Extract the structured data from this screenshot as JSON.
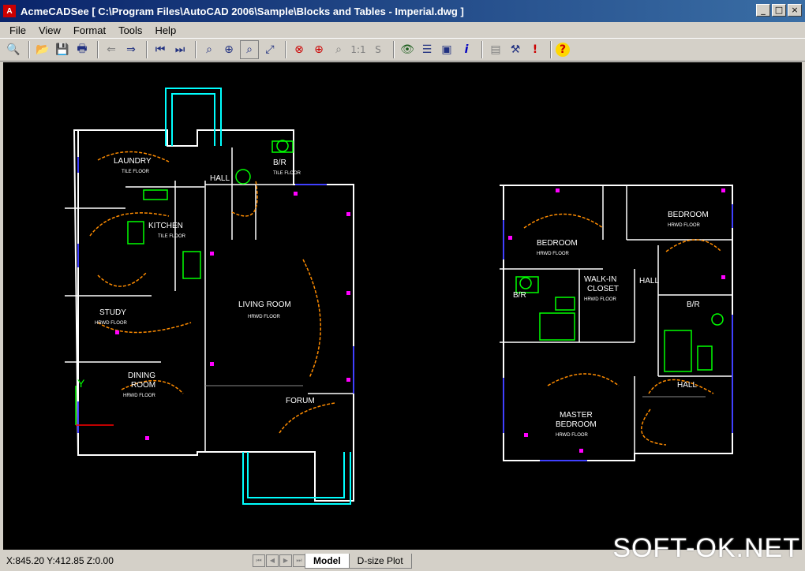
{
  "window": {
    "title": "AcmeCADSee [ C:\\Program Files\\AutoCAD 2006\\Sample\\Blocks and Tables - Imperial.dwg ]",
    "icon": "app-icon"
  },
  "menu": {
    "items": [
      "File",
      "View",
      "Format",
      "Tools",
      "Help"
    ]
  },
  "toolbar": {
    "one_to_one": "1:1",
    "s_label": "S",
    "info": "i",
    "bang": "!",
    "help": "?"
  },
  "drawing": {
    "labels": {
      "laundry": "LAUNDRY",
      "tile_floor": "TILE FLOOR",
      "kitchen": "KITCHEN",
      "hall": "HALL",
      "br": "B/R",
      "study": "STUDY",
      "hrwd_floor": "HRWD FLOOR",
      "living_room": "LIVING ROOM",
      "dining": "DINING",
      "room": "ROOM",
      "forum": "FORUM",
      "bedroom": "BEDROOM",
      "walk_in": "WALK-IN",
      "closet": "CLOSET",
      "master": "MASTER",
      "axis_y": "Y"
    }
  },
  "status": {
    "coords": "X:845.20 Y:412.85 Z:0.00",
    "tabs": [
      "Model",
      "D-size Plot"
    ],
    "active_tab": "Model"
  },
  "watermark": "SOFT-OK.NET",
  "colors": {
    "walls": "#ffffff",
    "wiring": "#ff8c00",
    "outlets": "#ff00ff",
    "dims": "#4040ff",
    "green": "#00ff00",
    "cyan": "#00ffff",
    "title_bg": "#0a246a"
  }
}
